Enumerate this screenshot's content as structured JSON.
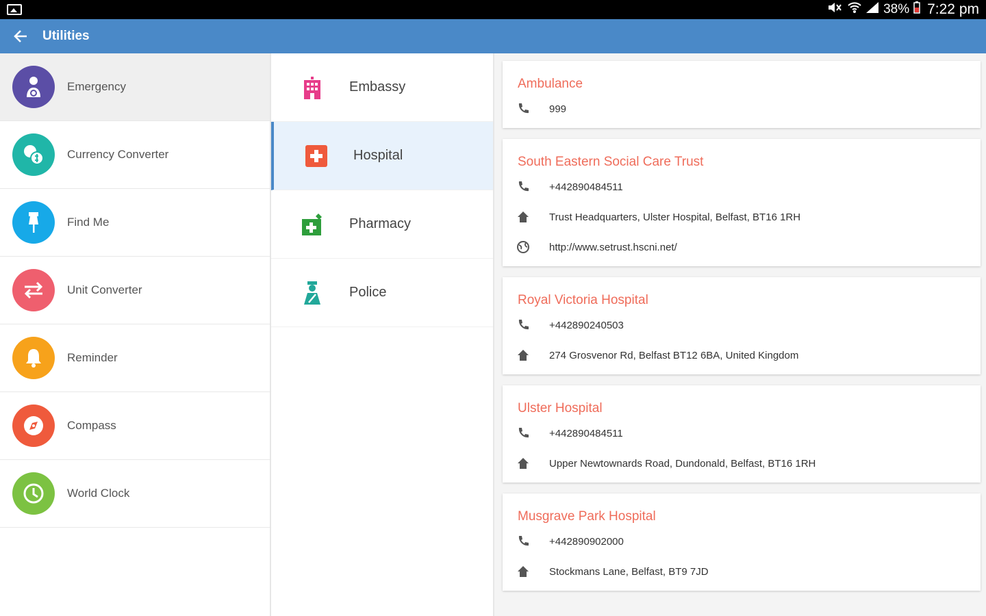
{
  "status_bar": {
    "battery": "38%",
    "time": "7:22 pm"
  },
  "app_bar": {
    "title": "Utilities"
  },
  "utilities": [
    {
      "label": "Emergency",
      "color": "#5b4ea6",
      "icon": "person-icon"
    },
    {
      "label": "Currency Converter",
      "color": "#20b6a8",
      "icon": "currency-icon"
    },
    {
      "label": "Find Me",
      "color": "#17a9e8",
      "icon": "pin-icon"
    },
    {
      "label": "Unit Converter",
      "color": "#ef5f6e",
      "icon": "swap-icon"
    },
    {
      "label": "Reminder",
      "color": "#f7a21b",
      "icon": "bell-icon"
    },
    {
      "label": "Compass",
      "color": "#ef5a3c",
      "icon": "compass-icon"
    },
    {
      "label": "World Clock",
      "color": "#7cc242",
      "icon": "clock-icon"
    }
  ],
  "categories": [
    {
      "label": "Embassy",
      "color": "#e73d8a",
      "icon": "building-icon"
    },
    {
      "label": "Hospital",
      "color": "#ef5a3c",
      "icon": "medical-cross-icon"
    },
    {
      "label": "Pharmacy",
      "color": "#2e9e3c",
      "icon": "pharmacy-icon"
    },
    {
      "label": "Police",
      "color": "#22a89a",
      "icon": "police-icon"
    }
  ],
  "contacts": [
    {
      "name": "Ambulance",
      "phone": "999"
    },
    {
      "name": "South Eastern Social Care Trust",
      "phone": "+442890484511",
      "address": "Trust Headquarters, Ulster Hospital,  Belfast, BT16 1RH",
      "website": "http://www.setrust.hscni.net/"
    },
    {
      "name": "Royal Victoria Hospital",
      "phone": "+442890240503",
      "address": "274 Grosvenor Rd,  Belfast BT12 6BA,  United Kingdom"
    },
    {
      "name": "Ulster Hospital",
      "phone": "+442890484511",
      "address": "Upper Newtownards Road,  Dundonald, Belfast,  BT16 1RH"
    },
    {
      "name": "Musgrave Park Hospital",
      "phone": "+442890902000",
      "address": "Stockmans Lane,  Belfast, BT9 7JD"
    }
  ]
}
